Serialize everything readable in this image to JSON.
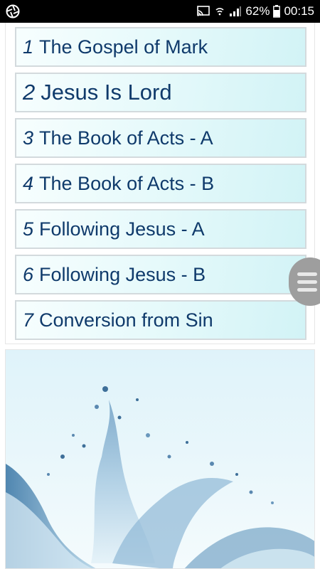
{
  "status_bar": {
    "battery_percent": "62%",
    "time": "00:15",
    "icons": [
      "aperture-icon",
      "cast-icon",
      "nfc-icon",
      "signal-icon",
      "battery-icon"
    ]
  },
  "lessons": [
    {
      "number": "1",
      "title": "The Gospel of Mark"
    },
    {
      "number": "2",
      "title": "Jesus Is Lord"
    },
    {
      "number": "3",
      "title": "The Book of Acts - A"
    },
    {
      "number": "4",
      "title": "The Book of Acts - B"
    },
    {
      "number": "5",
      "title": "Following Jesus - A"
    },
    {
      "number": "6",
      "title": "Following Jesus - B"
    },
    {
      "number": "7",
      "title": "Conversion from Sin"
    }
  ],
  "colors": {
    "text": "#0f3a6b",
    "item_gradient_end": "#d2f3f6",
    "handle": "#9e9e9e"
  },
  "image": {
    "icon": "water-splash-image"
  }
}
